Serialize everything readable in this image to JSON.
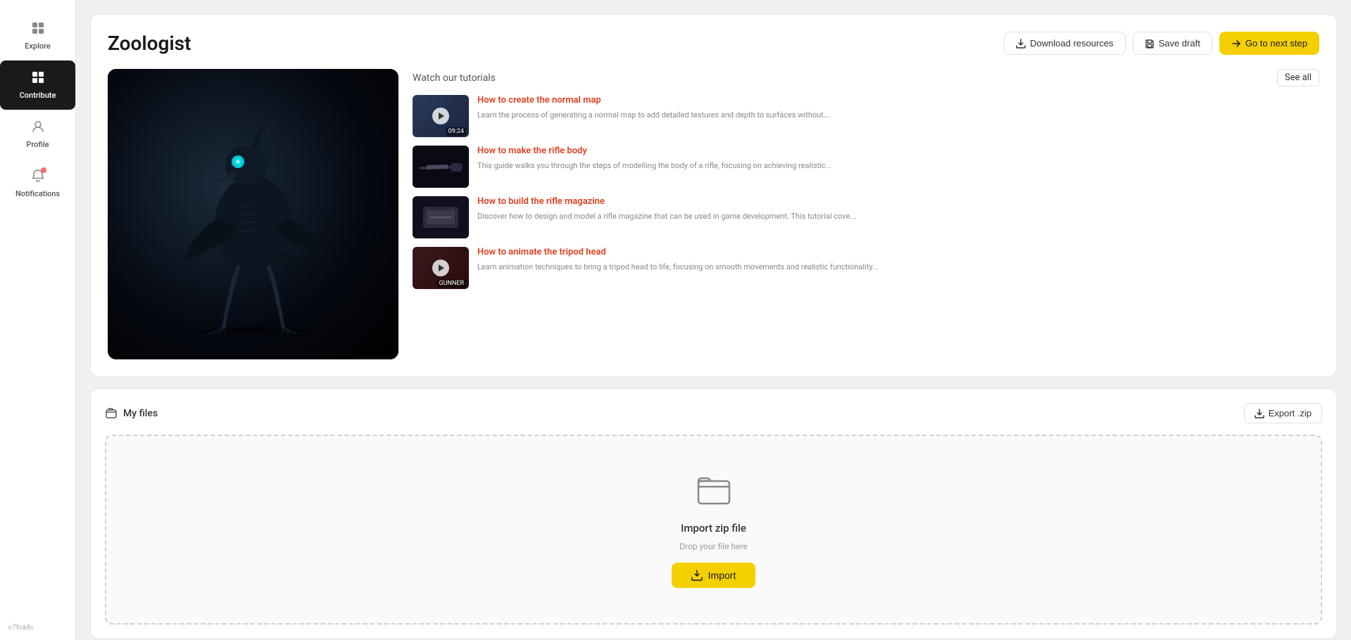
{
  "sidebar": {
    "items": [
      {
        "id": "explore",
        "label": "Explore",
        "icon": "⊞",
        "active": false
      },
      {
        "id": "contribute",
        "label": "Contribute",
        "icon": "＋",
        "active": true
      },
      {
        "id": "profile",
        "label": "Profile",
        "icon": "◉",
        "active": false
      },
      {
        "id": "notifications",
        "label": "Notifications",
        "icon": "🔔",
        "active": false,
        "hasAlert": true
      }
    ]
  },
  "header": {
    "title": "Zoologist",
    "actions": {
      "download_label": "Download resources",
      "save_label": "Save draft",
      "next_label": "Go to next step"
    }
  },
  "tutorials": {
    "section_title": "Watch our tutorials",
    "see_all_label": "See all",
    "items": [
      {
        "title": "How to create the normal map",
        "desc": "Learn the process of generating a normal map to add detailed textures and depth to surfaces without...",
        "duration": "09:24",
        "has_play": true,
        "thumb_class": "tutorial-thumb-bg-1"
      },
      {
        "title": "How to make the rifle body",
        "desc": "This guide walks you through the steps of modelling the body of a rifle, focusing on achieving realistic...",
        "duration": "",
        "has_play": false,
        "thumb_class": "tutorial-thumb-bg-2"
      },
      {
        "title": "How to build the rifle magazine",
        "desc": "Discover how to design and model a rifle magazine that can be used in game development. This tutorial cove...",
        "duration": "",
        "has_play": false,
        "thumb_class": "tutorial-thumb-bg-3"
      },
      {
        "title": "How to animate the tripod head",
        "desc": "Learn animation techniques to bring a tripod head to life, focusing on smooth movements and realistic functionality...",
        "duration": "GUNNER",
        "has_play": true,
        "thumb_class": "tutorial-thumb-bg-4"
      }
    ]
  },
  "files": {
    "section_title": "My files",
    "export_label": "Export .zip",
    "drop_title": "Import zip file",
    "drop_subtitle": "Drop your file here",
    "import_label": "Import"
  },
  "version": {
    "label": "c7fca4c"
  }
}
